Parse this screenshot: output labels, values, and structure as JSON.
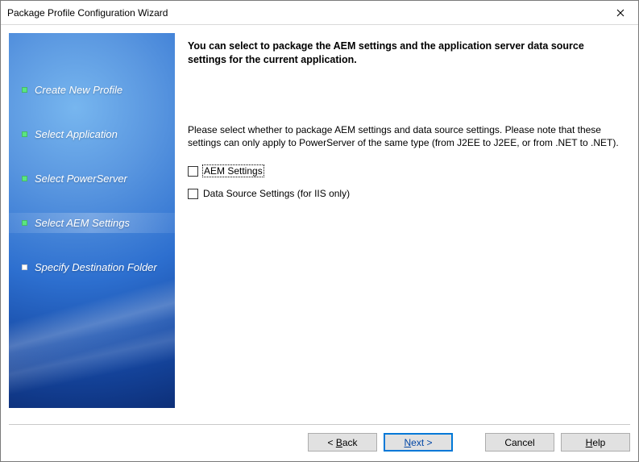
{
  "window": {
    "title": "Package Profile Configuration Wizard"
  },
  "sidebar": {
    "items": [
      {
        "label": "Create New Profile",
        "done": true,
        "active": false
      },
      {
        "label": "Select Application",
        "done": true,
        "active": false
      },
      {
        "label": "Select PowerServer",
        "done": true,
        "active": false
      },
      {
        "label": "Select AEM Settings",
        "done": true,
        "active": true
      },
      {
        "label": "Specify Destination Folder",
        "done": false,
        "active": false
      }
    ]
  },
  "main": {
    "heading": "You can select to package the AEM settings and the application server data source settings for the current application.",
    "instruction": "Please select whether to package AEM settings and data source settings. Please note that these settings can only apply to PowerServer of the same type (from J2EE to J2EE, or from .NET to .NET).",
    "checkboxes": [
      {
        "label": "AEM Settings",
        "checked": false,
        "focused": true
      },
      {
        "label": "Data Source Settings (for IIS only)",
        "checked": false,
        "focused": false
      }
    ]
  },
  "footer": {
    "back_prefix": "< ",
    "back_u": "B",
    "back_rest": "ack",
    "next_u": "N",
    "next_rest": "ext >",
    "cancel": "Cancel",
    "help_u": "H",
    "help_rest": "elp"
  }
}
